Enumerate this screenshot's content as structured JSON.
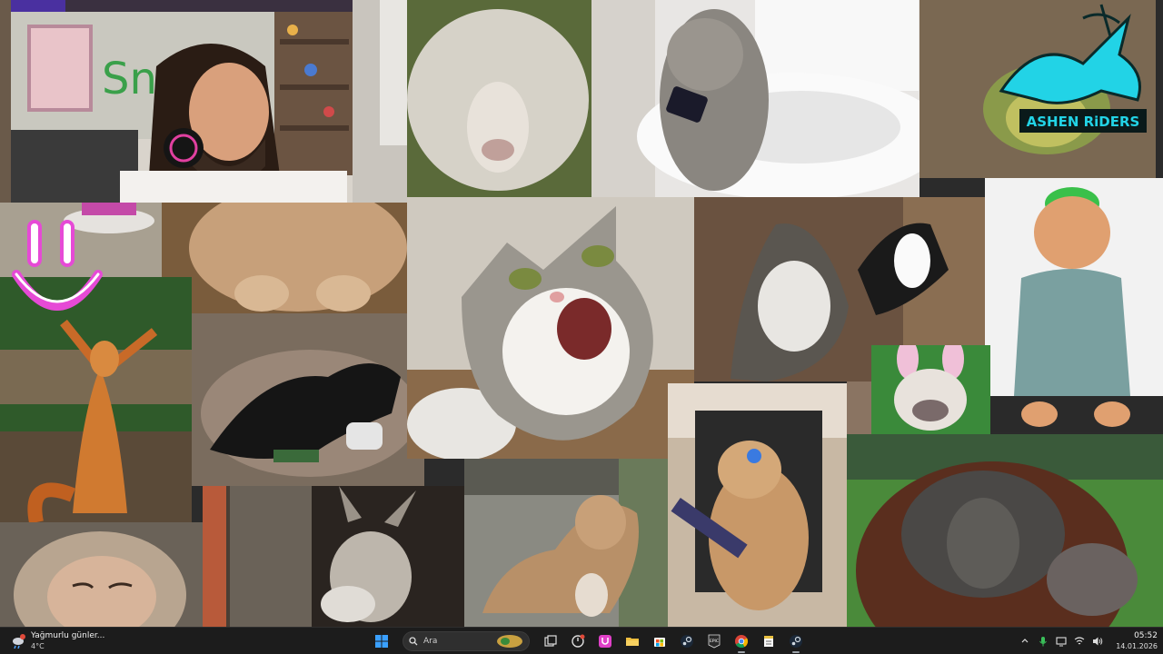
{
  "desktop": {
    "wallpaper_description_icons": [
      "streamer-webcam-icon",
      "sheep-icon",
      "cat-on-toilet-icon",
      "ashen-riders-logo-icon",
      "screaming-cat-icon",
      "dogs-fighting-icon",
      "cat-in-shirt-icon",
      "squirrel-icon",
      "black-dog-icon",
      "bulldog-bunny-ears-icon",
      "orangutan-icon",
      "monkey-icon",
      "donkey-icon",
      "dogs-street-icon",
      "gaming-cat-icon",
      "big-cat-icon"
    ],
    "logo_text": "ASHEN RiDERS",
    "colors": {
      "ashen_logo": "#22d3e6",
      "smile_logo": "#e64ad6"
    }
  },
  "taskbar": {
    "weather": {
      "title": "Yağmurlu günler...",
      "temp": "4°C",
      "icon": "rain-cloud-icon"
    },
    "search": {
      "label": "Ara",
      "icon": "search-icon"
    },
    "apps": [
      {
        "name": "start-button",
        "icon": "windows-icon"
      },
      {
        "name": "task-view",
        "icon": "task-view-icon"
      },
      {
        "name": "app-clock",
        "icon": "clock-app-icon"
      },
      {
        "name": "app-pink",
        "icon": "pink-app-icon"
      },
      {
        "name": "file-explorer",
        "icon": "folder-icon"
      },
      {
        "name": "microsoft-store",
        "icon": "store-icon"
      },
      {
        "name": "steam",
        "icon": "steam-icon"
      },
      {
        "name": "epic-games",
        "icon": "epic-games-icon",
        "text": "EPIC"
      },
      {
        "name": "chrome",
        "icon": "chrome-icon"
      },
      {
        "name": "notepad",
        "icon": "notepad-icon"
      },
      {
        "name": "steam-active",
        "icon": "steam-icon"
      }
    ],
    "tray": {
      "chevron": "chevron-up-icon",
      "mic": "microphone-icon",
      "display": "display-icon",
      "wifi": "wifi-icon",
      "volume": "volume-icon"
    },
    "clock": {
      "time": "05:52",
      "date": "14.01.2026"
    }
  }
}
